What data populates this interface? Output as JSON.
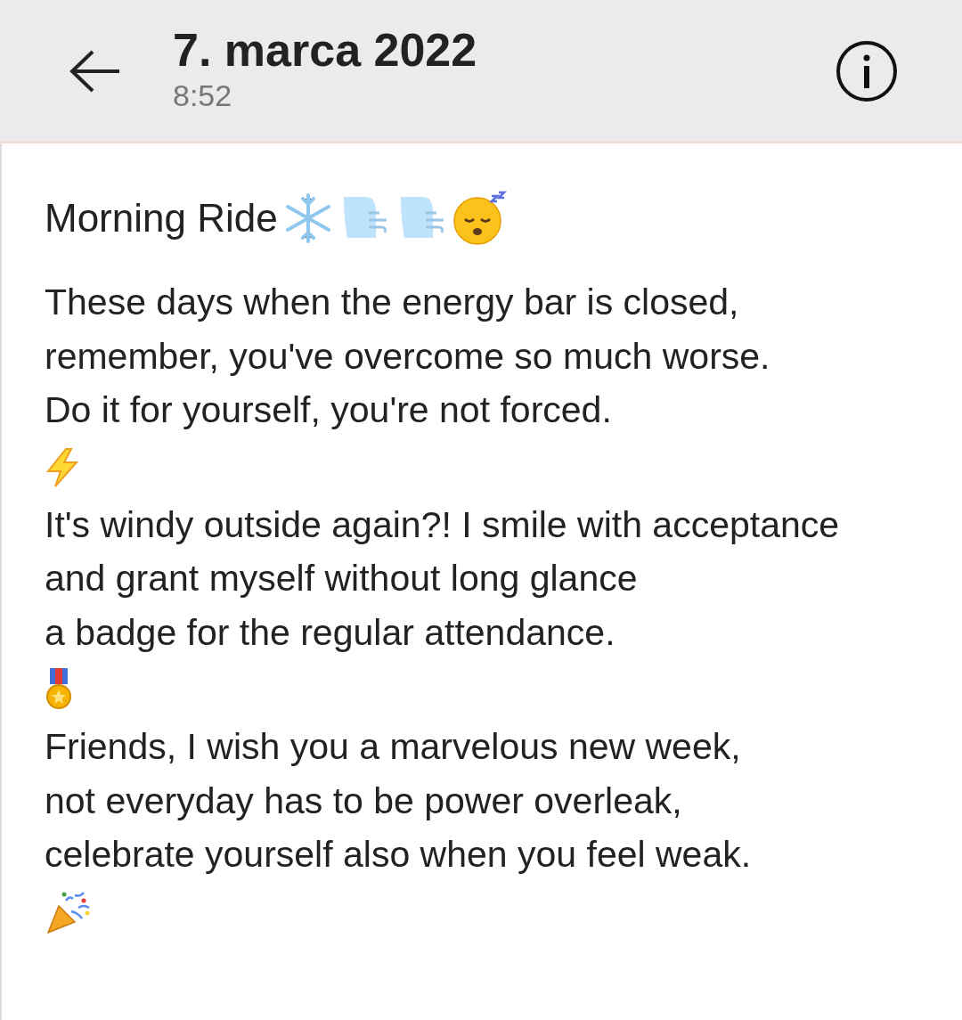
{
  "header": {
    "title": "7. marca 2022",
    "time": "8:52"
  },
  "post": {
    "title": "Morning Ride",
    "blocks": [
      {
        "kind": "text",
        "text": "These days when the energy bar is closed,"
      },
      {
        "kind": "text",
        "text": "remember, you've overcome so much worse."
      },
      {
        "kind": "text",
        "text": "Do it for yourself, you're not forced."
      },
      {
        "kind": "lightning"
      },
      {
        "kind": "text",
        "text": "It's windy outside again?! I smile with acceptance"
      },
      {
        "kind": "text",
        "text": "and grant myself without long glance"
      },
      {
        "kind": "text",
        "text": "a badge for the regular attendance."
      },
      {
        "kind": "medal"
      },
      {
        "kind": "text",
        "text": "Friends, I wish you a marvelous new week,"
      },
      {
        "kind": "text",
        "text": "not everyday has to be power overleak,"
      },
      {
        "kind": "text",
        "text": "celebrate yourself also when you feel weak."
      },
      {
        "kind": "party"
      }
    ]
  }
}
